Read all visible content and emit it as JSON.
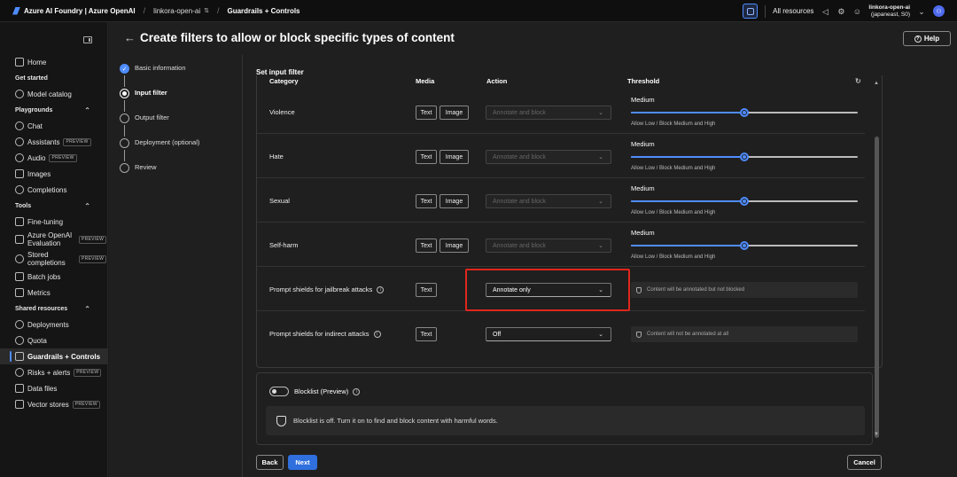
{
  "topbar": {
    "brand": "Azure AI Foundry | Azure OpenAI",
    "project": "linkora-open-ai",
    "page": "Guardrails + Controls",
    "all_resources": "All resources",
    "account_name": "linkora-open-ai",
    "account_region": "(japaneast, S0)"
  },
  "sidebar": {
    "home": "Home",
    "get_started": "Get started",
    "model_catalog": "Model catalog",
    "playgrounds": "Playgrounds",
    "chat": "Chat",
    "assistants": "Assistants",
    "audio": "Audio",
    "images": "Images",
    "completions": "Completions",
    "tools": "Tools",
    "fine_tuning": "Fine-tuning",
    "evaluation": "Azure OpenAI Evaluation",
    "stored_completions": "Stored completions",
    "batch_jobs": "Batch jobs",
    "metrics": "Metrics",
    "shared_resources": "Shared resources",
    "deployments": "Deployments",
    "quota": "Quota",
    "guardrails": "Guardrails + Controls",
    "risks_alerts": "Risks + alerts",
    "data_files": "Data files",
    "vector_stores": "Vector stores",
    "preview_badge": "PREVIEW"
  },
  "header": {
    "title": "Create filters to allow or block specific types of content",
    "help": "Help"
  },
  "steps": [
    {
      "label": "Basic information"
    },
    {
      "label": "Input filter"
    },
    {
      "label": "Output filter"
    },
    {
      "label": "Deployment (optional)"
    },
    {
      "label": "Review"
    }
  ],
  "section_title": "Set input filter",
  "columns": {
    "category": "Category",
    "media": "Media",
    "action": "Action",
    "threshold": "Threshold"
  },
  "media": {
    "text": "Text",
    "image": "Image"
  },
  "rows": [
    {
      "category": "Violence",
      "action": "Annotate and block",
      "threshold": "Medium",
      "level_pct": 50,
      "desc": "Allow Low / Block Medium and High"
    },
    {
      "category": "Hate",
      "action": "Annotate and block",
      "threshold": "Medium",
      "level_pct": 50,
      "desc": "Allow Low / Block Medium and High"
    },
    {
      "category": "Sexual",
      "action": "Annotate and block",
      "threshold": "Medium",
      "level_pct": 50,
      "desc": "Allow Low / Block Medium and High"
    },
    {
      "category": "Self-harm",
      "action": "Annotate and block",
      "threshold": "Medium",
      "level_pct": 50,
      "desc": "Allow Low / Block Medium and High"
    },
    {
      "category": "Prompt shields for jailbreak attacks",
      "action": "Annotate only",
      "note": "Content will be annotated but not blocked"
    },
    {
      "category": "Prompt shields for indirect attacks",
      "action": "Off",
      "note": "Content will not be annotated at all"
    }
  ],
  "blocklist": {
    "label": "Blocklist (Preview)",
    "message": "Blocklist is off. Turn it on to find and block content with harmful words."
  },
  "buttons": {
    "back": "Back",
    "next": "Next",
    "cancel": "Cancel"
  }
}
